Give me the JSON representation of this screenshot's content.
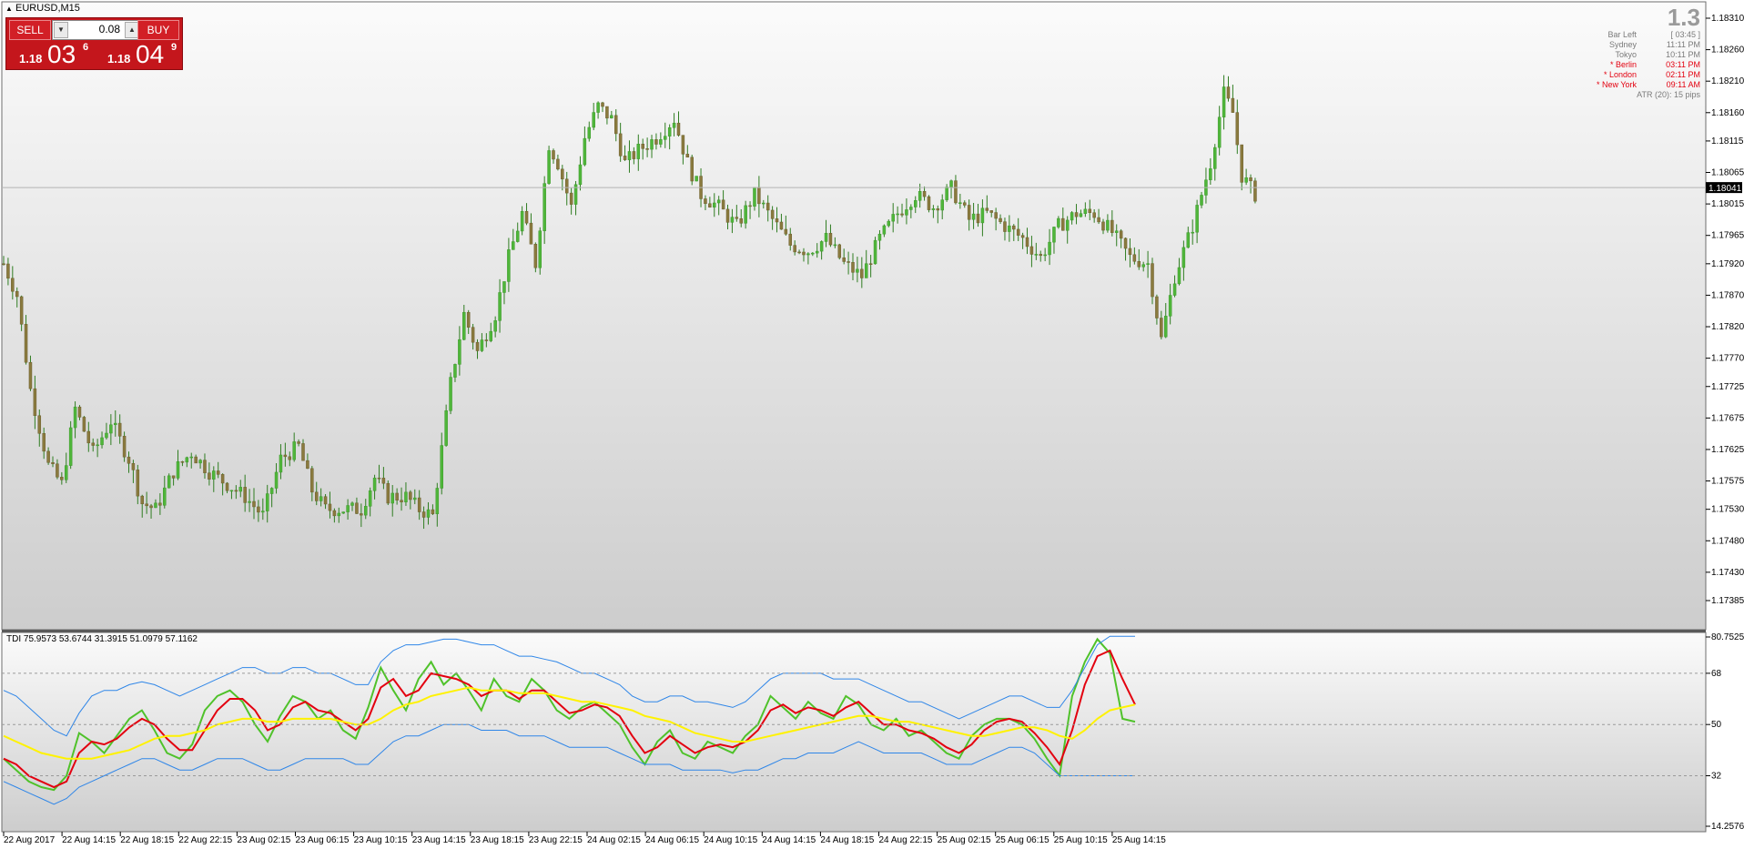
{
  "window": {
    "title": "EURUSD,M15"
  },
  "trade_panel": {
    "sell_label": "SELL",
    "buy_label": "BUY",
    "lot": "0.08",
    "sell_quote": {
      "small": "1.18",
      "big": "03",
      "sup": "6"
    },
    "buy_quote": {
      "small": "1.18",
      "big": "04",
      "sup": "9"
    }
  },
  "info_panel": {
    "big_value": "1.3",
    "rows": [
      {
        "label": "Bar Left",
        "value": "[ 03:45 ]",
        "color": "#7a7a7a"
      },
      {
        "label": "Sydney",
        "value": "11:11 PM",
        "color": "#7a7a7a"
      },
      {
        "label": "Tokyo",
        "value": "10:11 PM",
        "color": "#7a7a7a"
      },
      {
        "label": "* Berlin",
        "value": "03:11 PM",
        "color": "#e3000f"
      },
      {
        "label": "* London",
        "value": "02:11 PM",
        "color": "#e3000f"
      },
      {
        "label": "* New York",
        "value": "09:11 AM",
        "color": "#e3000f"
      }
    ],
    "atr": "ATR (20): 15 pips"
  },
  "chart_data": [
    {
      "type": "candlestick",
      "symbol": "EURUSD",
      "timeframe": "M15",
      "current_price": 1.18041,
      "current_price_label": "1.18041",
      "ylim": [
        1.17385,
        1.1831
      ],
      "yticks": [
        "1.18310",
        "1.18260",
        "1.18210",
        "1.18160",
        "1.18115",
        "1.18065",
        "1.18015",
        "1.17965",
        "1.17920",
        "1.17870",
        "1.17820",
        "1.17770",
        "1.17725",
        "1.17675",
        "1.17625",
        "1.17575",
        "1.17530",
        "1.17480",
        "1.17430",
        "1.17385"
      ],
      "xticks": [
        "22 Aug 2017",
        "22 Aug 14:15",
        "22 Aug 18:15",
        "22 Aug 22:15",
        "23 Aug 02:15",
        "23 Aug 06:15",
        "23 Aug 10:15",
        "23 Aug 14:15",
        "23 Aug 18:15",
        "23 Aug 22:15",
        "24 Aug 02:15",
        "24 Aug 06:15",
        "24 Aug 10:15",
        "24 Aug 14:15",
        "24 Aug 18:15",
        "24 Aug 22:15",
        "25 Aug 02:15",
        "25 Aug 06:15",
        "25 Aug 10:15",
        "25 Aug 14:15"
      ],
      "colors": {
        "bull": "#4fb63a",
        "bear": "#8a7a3e",
        "wick": "#2f7d21"
      },
      "close_path": [
        [
          0,
          1.1792
        ],
        [
          3,
          1.1787
        ],
        [
          6,
          1.1772
        ],
        [
          10,
          1.176
        ],
        [
          13,
          1.1757
        ],
        [
          16,
          1.1769
        ],
        [
          20,
          1.1762
        ],
        [
          24,
          1.1767
        ],
        [
          28,
          1.1761
        ],
        [
          31,
          1.1754
        ],
        [
          34,
          1.1753
        ],
        [
          38,
          1.1759
        ],
        [
          42,
          1.1762
        ],
        [
          46,
          1.1759
        ],
        [
          50,
          1.1757
        ],
        [
          54,
          1.1755
        ],
        [
          58,
          1.1752
        ],
        [
          62,
          1.1761
        ],
        [
          66,
          1.1763
        ],
        [
          69,
          1.1756
        ],
        [
          72,
          1.1753
        ],
        [
          76,
          1.1753
        ],
        [
          80,
          1.1753
        ],
        [
          83,
          1.1758
        ],
        [
          86,
          1.1755
        ],
        [
          90,
          1.1755
        ],
        [
          93,
          1.1753
        ],
        [
          96,
          1.1752
        ],
        [
          100,
          1.1773
        ],
        [
          103,
          1.1784
        ],
        [
          106,
          1.1778
        ],
        [
          110,
          1.1784
        ],
        [
          113,
          1.1793
        ],
        [
          116,
          1.18
        ],
        [
          119,
          1.1792
        ],
        [
          122,
          1.1811
        ],
        [
          124,
          1.1808
        ],
        [
          127,
          1.1801
        ],
        [
          130,
          1.1812
        ],
        [
          133,
          1.1817
        ],
        [
          136,
          1.1815
        ],
        [
          139,
          1.1808
        ],
        [
          142,
          1.181
        ],
        [
          146,
          1.1812
        ],
        [
          150,
          1.1815
        ],
        [
          153,
          1.1808
        ],
        [
          156,
          1.1803
        ],
        [
          160,
          1.1801
        ],
        [
          164,
          1.1798
        ],
        [
          168,
          1.1803
        ],
        [
          172,
          1.1799
        ],
        [
          176,
          1.1795
        ],
        [
          180,
          1.1794
        ],
        [
          184,
          1.1796
        ],
        [
          188,
          1.1792
        ],
        [
          192,
          1.179
        ],
        [
          196,
          1.1796
        ],
        [
          200,
          1.18
        ],
        [
          204,
          1.1803
        ],
        [
          208,
          1.1801
        ],
        [
          212,
          1.1804
        ],
        [
          216,
          1.1799
        ],
        [
          220,
          1.18
        ],
        [
          224,
          1.1798
        ],
        [
          228,
          1.1796
        ],
        [
          232,
          1.1793
        ],
        [
          236,
          1.1798
        ],
        [
          240,
          1.18
        ],
        [
          244,
          1.18
        ],
        [
          248,
          1.1797
        ],
        [
          252,
          1.1793
        ],
        [
          256,
          1.1792
        ],
        [
          259,
          1.178
        ],
        [
          262,
          1.179
        ],
        [
          266,
          1.1798
        ],
        [
          270,
          1.1808
        ],
        [
          273,
          1.1819
        ],
        [
          275,
          1.1816
        ],
        [
          277,
          1.1806
        ],
        [
          280,
          1.1803
        ]
      ]
    },
    {
      "type": "line",
      "name": "TDI",
      "header": "TDI 75.9573 53.6744 31.3915 51.0979 57.1162",
      "ylim": [
        14.2576,
        80.7525
      ],
      "yticks": [
        "80.7525",
        "68",
        "50",
        "32",
        "14.2576"
      ],
      "levels": [
        68,
        50,
        32
      ],
      "series": [
        {
          "color": "#4fc22a",
          "values": [
            38,
            34,
            30,
            28,
            27,
            32,
            47,
            44,
            40,
            46,
            52,
            55,
            48,
            40,
            38,
            43,
            55,
            60,
            62,
            58,
            50,
            44,
            53,
            60,
            58,
            52,
            55,
            48,
            45,
            56,
            70,
            62,
            55,
            66,
            72,
            64,
            68,
            62,
            55,
            66,
            60,
            58,
            66,
            62,
            55,
            52,
            56,
            58,
            54,
            50,
            42,
            36,
            44,
            48,
            40,
            38,
            44,
            42,
            40,
            46,
            50,
            60,
            56,
            52,
            58,
            54,
            52,
            60,
            57,
            50,
            48,
            52,
            46,
            48,
            44,
            40,
            38,
            46,
            50,
            52,
            52,
            50,
            45,
            38,
            32,
            60,
            72,
            80,
            75,
            52,
            51
          ]
        },
        {
          "color": "#e3000f",
          "values": [
            38,
            36,
            32,
            30,
            28,
            30,
            40,
            44,
            43,
            45,
            49,
            52,
            50,
            45,
            41,
            41,
            48,
            55,
            59,
            59,
            55,
            48,
            50,
            56,
            58,
            55,
            54,
            51,
            48,
            52,
            63,
            66,
            60,
            62,
            68,
            67,
            66,
            64,
            60,
            62,
            62,
            59,
            62,
            62,
            58,
            54,
            55,
            57,
            56,
            53,
            46,
            40,
            42,
            46,
            43,
            40,
            42,
            43,
            42,
            44,
            48,
            55,
            57,
            54,
            56,
            55,
            53,
            56,
            58,
            54,
            50,
            50,
            48,
            47,
            45,
            42,
            40,
            43,
            48,
            51,
            52,
            51,
            47,
            42,
            36,
            48,
            64,
            74,
            76,
            66,
            57
          ]
        },
        {
          "color": "#fff200",
          "values": [
            46,
            44,
            42,
            40,
            39,
            38,
            38,
            38,
            39,
            40,
            41,
            43,
            45,
            46,
            46,
            47,
            48,
            50,
            51,
            52,
            52,
            51,
            51,
            52,
            52,
            52,
            52,
            51,
            50,
            50,
            52,
            55,
            57,
            58,
            60,
            61,
            62,
            63,
            62,
            62,
            62,
            61,
            61,
            61,
            60,
            59,
            58,
            58,
            57,
            56,
            55,
            53,
            52,
            51,
            49,
            47,
            46,
            45,
            44,
            44,
            45,
            46,
            47,
            48,
            49,
            50,
            51,
            52,
            53,
            53,
            52,
            51,
            51,
            50,
            49,
            48,
            47,
            46,
            46,
            47,
            48,
            49,
            49,
            48,
            46,
            45,
            48,
            52,
            55,
            56,
            57
          ]
        },
        {
          "color": "#2f86e8",
          "name_hidden": true,
          "values": [
            62,
            60,
            56,
            52,
            48,
            46,
            54,
            60,
            62,
            62,
            64,
            65,
            64,
            62,
            60,
            62,
            64,
            66,
            68,
            70,
            70,
            68,
            68,
            70,
            70,
            68,
            68,
            66,
            64,
            64,
            72,
            76,
            78,
            78,
            79,
            80,
            80,
            79,
            78,
            78,
            76,
            74,
            74,
            73,
            72,
            70,
            68,
            68,
            66,
            64,
            60,
            58,
            58,
            60,
            60,
            58,
            58,
            57,
            56,
            58,
            62,
            66,
            68,
            68,
            68,
            68,
            66,
            66,
            66,
            64,
            62,
            60,
            58,
            58,
            56,
            54,
            52,
            54,
            56,
            58,
            60,
            60,
            58,
            56,
            56,
            62,
            70,
            78,
            81,
            81,
            81
          ]
        },
        {
          "color": "#2f86e8",
          "name_hidden": true,
          "values": [
            30,
            28,
            26,
            24,
            22,
            24,
            28,
            30,
            32,
            34,
            36,
            38,
            38,
            36,
            34,
            34,
            36,
            38,
            38,
            38,
            36,
            34,
            34,
            36,
            38,
            38,
            38,
            38,
            36,
            36,
            40,
            44,
            46,
            46,
            48,
            50,
            50,
            50,
            48,
            48,
            48,
            46,
            46,
            46,
            44,
            42,
            42,
            42,
            42,
            40,
            38,
            36,
            36,
            36,
            34,
            34,
            34,
            34,
            33,
            34,
            34,
            36,
            38,
            38,
            40,
            40,
            40,
            42,
            44,
            42,
            40,
            40,
            40,
            40,
            38,
            36,
            36,
            36,
            38,
            40,
            42,
            42,
            40,
            36,
            32,
            32,
            32,
            32,
            32,
            32,
            32
          ]
        }
      ]
    }
  ]
}
